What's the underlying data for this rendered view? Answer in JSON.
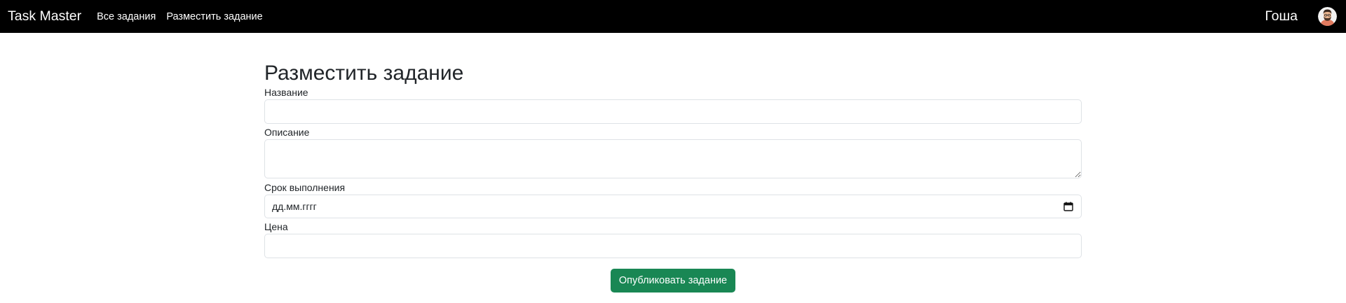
{
  "navbar": {
    "brand": "Task Master",
    "links": [
      {
        "label": "Все задания"
      },
      {
        "label": "Разместить задание"
      }
    ],
    "username": "Гоша",
    "avatar_icon": "user-avatar"
  },
  "form": {
    "title": "Разместить задание",
    "fields": {
      "title": {
        "label": "Название",
        "value": ""
      },
      "description": {
        "label": "Описание",
        "value": ""
      },
      "deadline": {
        "label": "Срок выполнения",
        "value": "дд.мм.гггг",
        "icon": "calendar-icon"
      },
      "price": {
        "label": "Цена",
        "value": ""
      }
    },
    "submit_label": "Опубликовать задание"
  },
  "colors": {
    "navbar_bg": "#000000",
    "primary_button": "#198754",
    "input_border": "#dee2e6"
  }
}
